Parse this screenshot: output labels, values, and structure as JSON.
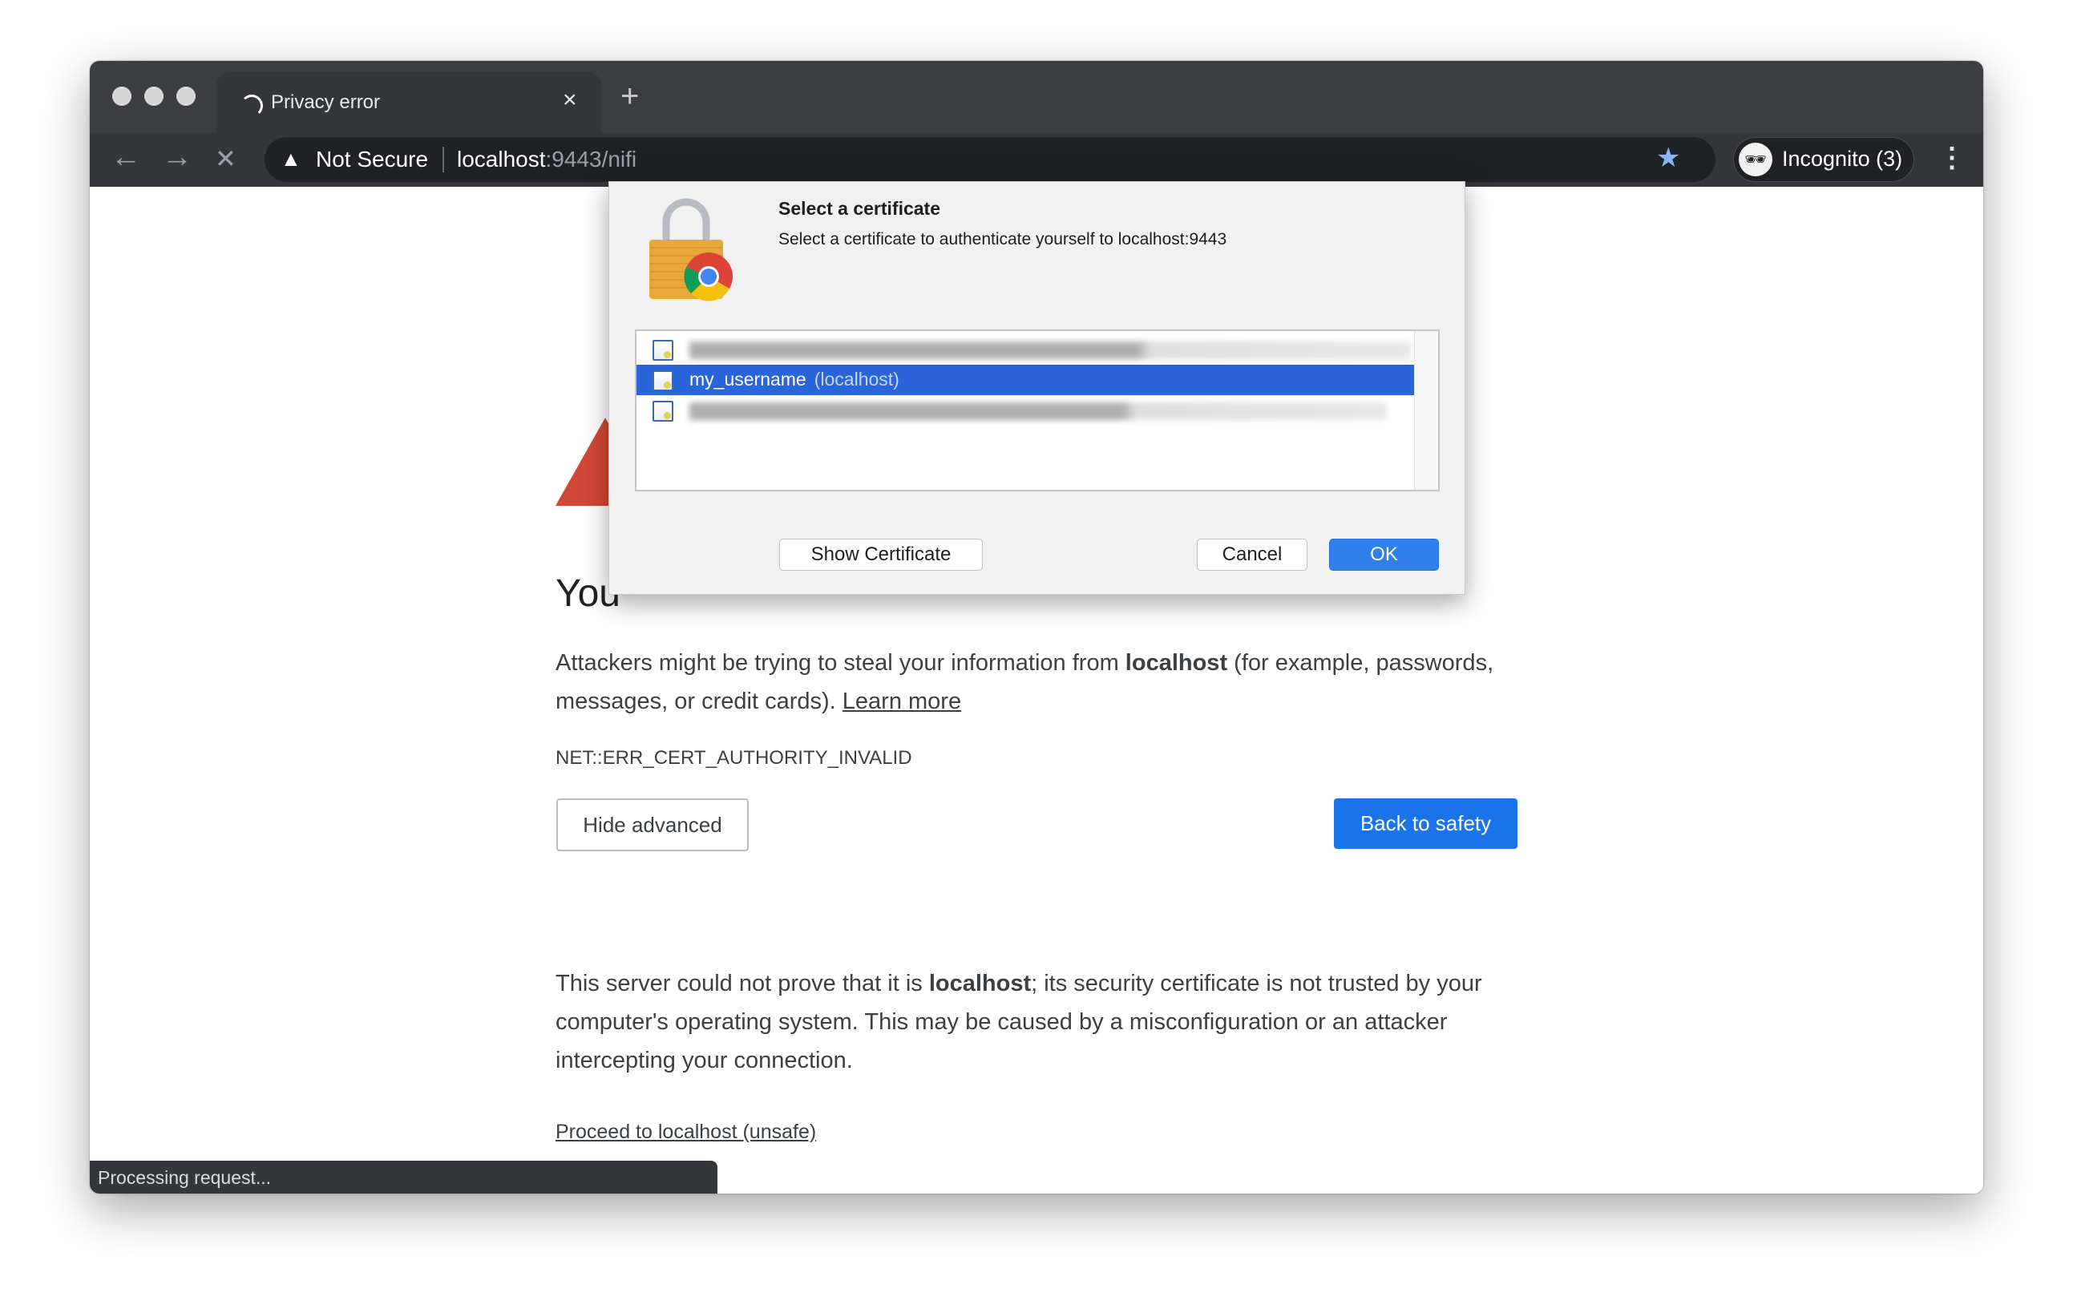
{
  "browser": {
    "tab": {
      "title": "Privacy error",
      "close": "×"
    },
    "new_tab": "+",
    "nav": {
      "back": "←",
      "forward": "→",
      "stop": "✕"
    },
    "omnibox": {
      "security_label": "Not Secure",
      "url_host": "localhost",
      "url_rest": ":9443/nifi"
    },
    "profile": {
      "label": "Incognito (3)"
    },
    "menu": "⋮",
    "status": "Processing request..."
  },
  "page": {
    "heading_visible": "You",
    "p1_a": "Attackers might be trying to steal your information from ",
    "p1_b": "localhost",
    "p1_c": " (for example, passwords, messages, or credit cards). ",
    "learn_more": "Learn more",
    "error_code": "NET::ERR_CERT_AUTHORITY_INVALID",
    "hide_advanced": "Hide advanced",
    "back_to_safety": "Back to safety",
    "p2_a": "This server could not prove that it is ",
    "p2_b": "localhost",
    "p2_c": "; its security certificate is not trusted by your computer's operating system. This may be caused by a misconfiguration or an attacker intercepting your connection.",
    "proceed": "Proceed to localhost (unsafe)"
  },
  "dialog": {
    "title": "Select a certificate",
    "subtitle": "Select a certificate to authenticate yourself to localhost:9443",
    "selected_cert": {
      "name": "my_username",
      "issuer": "(localhost)"
    },
    "show_certificate": "Show Certificate",
    "cancel": "Cancel",
    "ok": "OK"
  },
  "colors": {
    "accent": "#1a73e8",
    "selection": "#2965d9",
    "warning": "#d14836"
  }
}
